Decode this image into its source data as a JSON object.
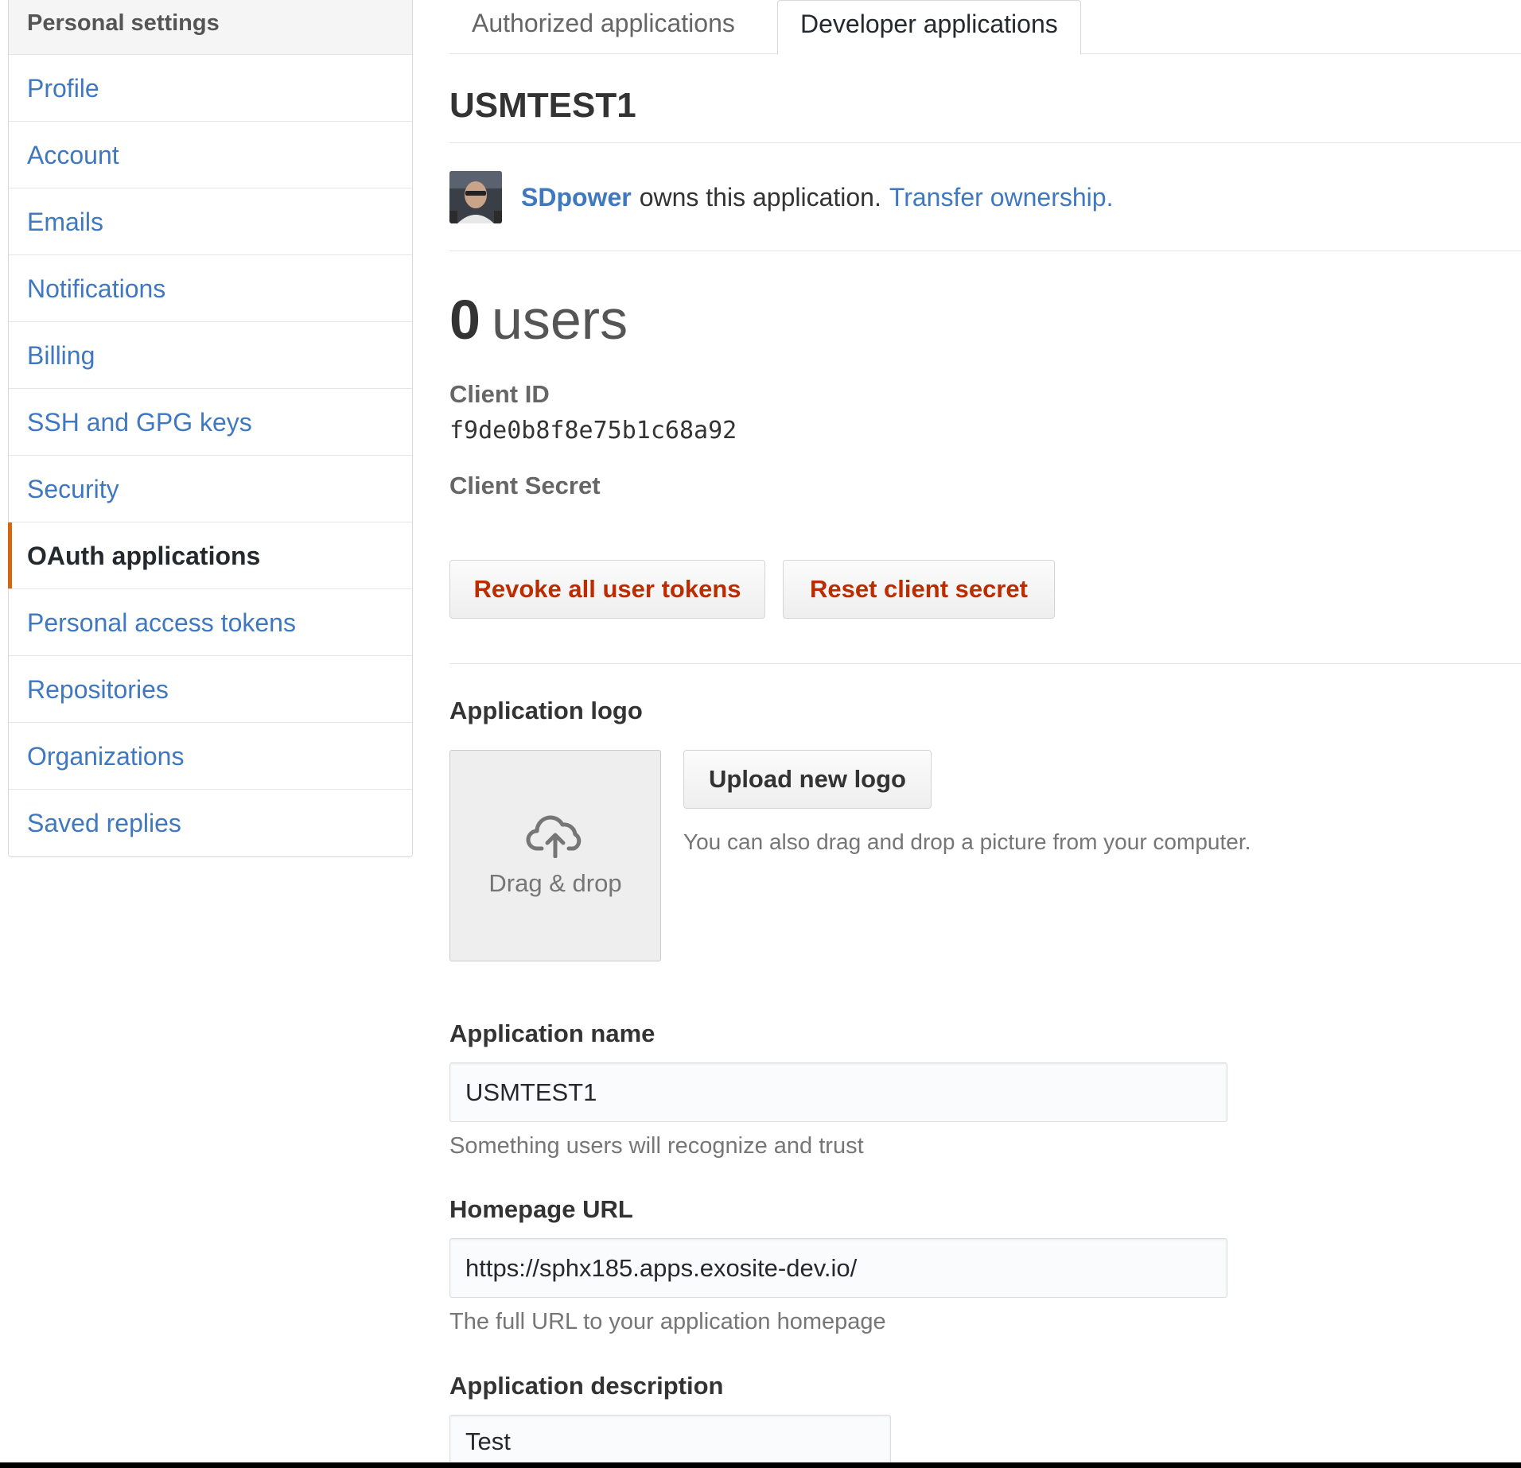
{
  "sidebar": {
    "heading": "Personal settings",
    "items": [
      {
        "label": "Profile"
      },
      {
        "label": "Account"
      },
      {
        "label": "Emails"
      },
      {
        "label": "Notifications"
      },
      {
        "label": "Billing"
      },
      {
        "label": "SSH and GPG keys"
      },
      {
        "label": "Security"
      },
      {
        "label": "OAuth applications",
        "selected": true
      },
      {
        "label": "Personal access tokens"
      },
      {
        "label": "Repositories"
      },
      {
        "label": "Organizations"
      },
      {
        "label": "Saved replies"
      }
    ]
  },
  "tabs": [
    {
      "label": "Authorized applications"
    },
    {
      "label": "Developer applications",
      "selected": true
    }
  ],
  "app": {
    "title": "USMTEST1",
    "owner_name": "SDpower",
    "owner_text": "owns this application.",
    "transfer_link": "Transfer ownership.",
    "users_count": "0",
    "users_label": "users",
    "client_id_label": "Client ID",
    "client_id": "f9de0b8f8e75b1c68a92",
    "client_secret_label": "Client Secret"
  },
  "buttons": {
    "revoke": "Revoke all user tokens",
    "reset": "Reset client secret",
    "upload": "Upload new logo"
  },
  "logo": {
    "label": "Application logo",
    "dropzone_text": "Drag & drop",
    "hint": "You can also drag and drop a picture from your computer.",
    "icon": "cloud-upload-icon"
  },
  "form": {
    "name_label": "Application name",
    "name_value": "USMTEST1",
    "name_hint": "Something users will recognize and trust",
    "homepage_label": "Homepage URL",
    "homepage_value": "https://sphx185.apps.exosite-dev.io/",
    "homepage_hint": "The full URL to your application homepage",
    "description_label": "Application description",
    "description_value": "Test"
  },
  "colors": {
    "link": "#4078c0",
    "danger": "#bd2c00",
    "selected_indicator": "#d26911"
  }
}
